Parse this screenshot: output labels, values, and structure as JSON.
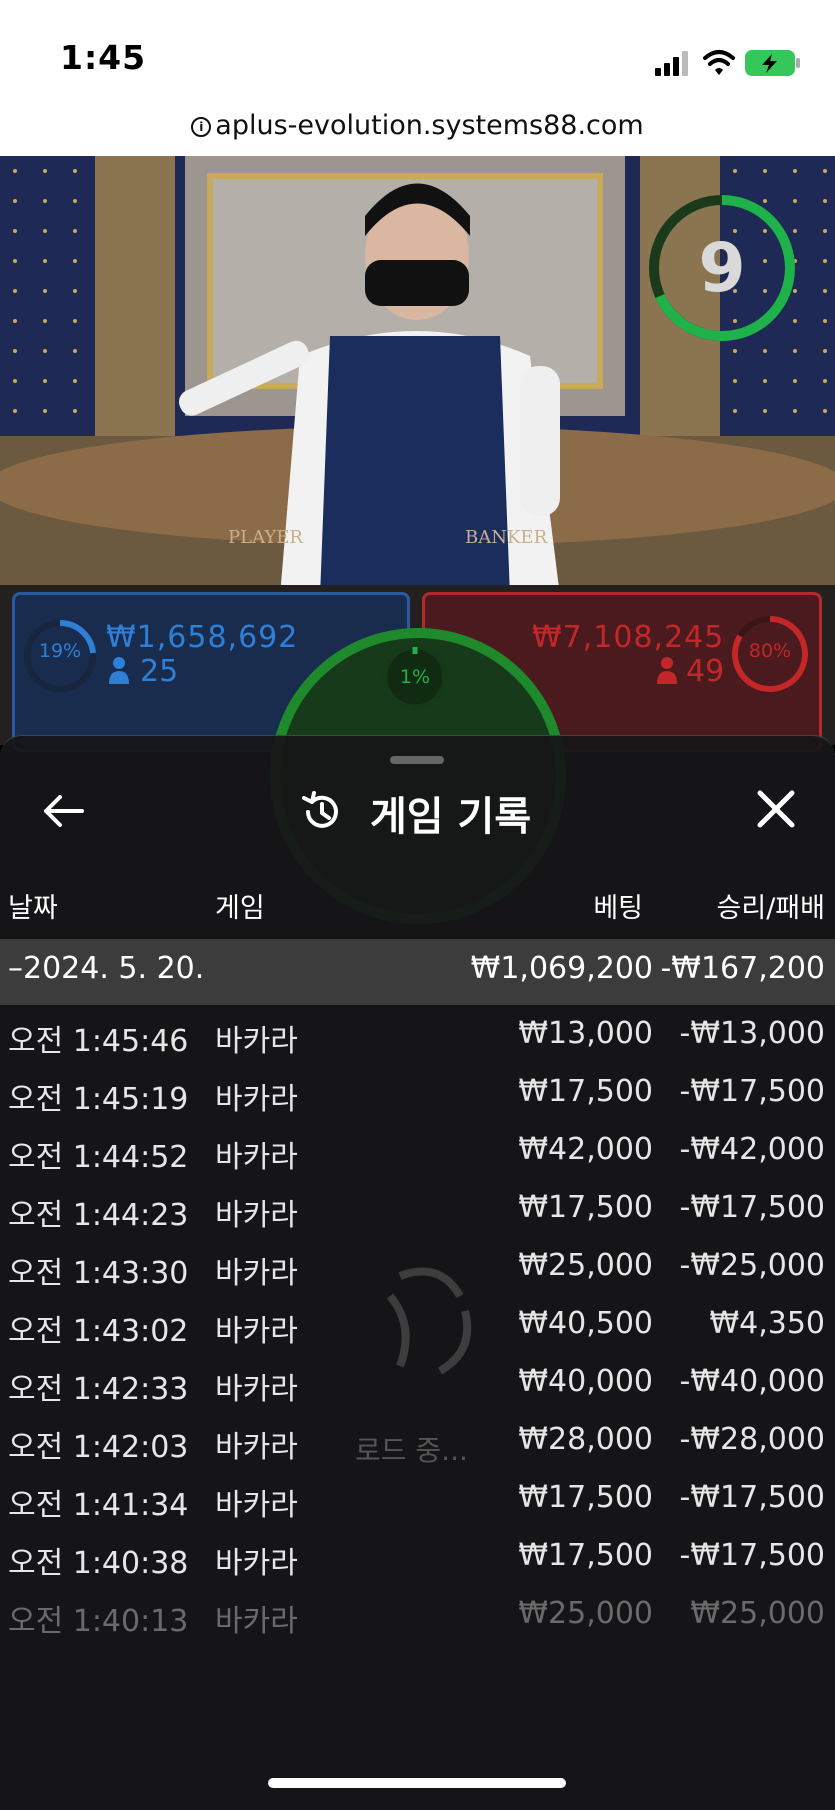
{
  "status_bar": {
    "time": "1:45"
  },
  "browser": {
    "url": "aplus-evolution.systems88.com"
  },
  "video": {
    "countdown": "9",
    "table_labels": [
      "PLAYER",
      "BANKER"
    ]
  },
  "bets": {
    "player": {
      "percent": "19%",
      "amount": "₩1,658,692",
      "count": "25",
      "color": "#2f7fd6"
    },
    "banker": {
      "percent": "80%",
      "amount": "₩7,108,245",
      "count": "49",
      "color": "#c42727"
    },
    "tie": {
      "percent": "1%",
      "color": "#1f8a2c"
    }
  },
  "panel": {
    "title": "게임 기록",
    "headers": {
      "date": "날짜",
      "game": "게임",
      "bet": "베팅",
      "result": "승리/패배"
    },
    "date_group": {
      "label": "–2024. 5. 20.",
      "bet": "₩1,069,200",
      "result": "-₩167,200"
    },
    "rows": [
      {
        "time": "오전 1:45:46",
        "game": "바카라",
        "bet": "₩13,000",
        "result": "-₩13,000"
      },
      {
        "time": "오전 1:45:19",
        "game": "바카라",
        "bet": "₩17,500",
        "result": "-₩17,500"
      },
      {
        "time": "오전 1:44:52",
        "game": "바카라",
        "bet": "₩42,000",
        "result": "-₩42,000"
      },
      {
        "time": "오전 1:44:23",
        "game": "바카라",
        "bet": "₩17,500",
        "result": "-₩17,500"
      },
      {
        "time": "오전 1:43:30",
        "game": "바카라",
        "bet": "₩25,000",
        "result": "-₩25,000"
      },
      {
        "time": "오전 1:43:02",
        "game": "바카라",
        "bet": "₩40,500",
        "result": "₩4,350"
      },
      {
        "time": "오전 1:42:33",
        "game": "바카라",
        "bet": "₩40,000",
        "result": "-₩40,000"
      },
      {
        "time": "오전 1:42:03",
        "game": "바카라",
        "bet": "₩28,000",
        "result": "-₩28,000"
      },
      {
        "time": "오전 1:41:34",
        "game": "바카라",
        "bet": "₩17,500",
        "result": "-₩17,500"
      },
      {
        "time": "오전 1:40:38",
        "game": "바카라",
        "bet": "₩17,500",
        "result": "-₩17,500"
      },
      {
        "time": "오전 1:40:13",
        "game": "바카라",
        "bet": "₩25,000",
        "result": "₩25,000"
      }
    ],
    "loading_text": "로드 중..."
  }
}
